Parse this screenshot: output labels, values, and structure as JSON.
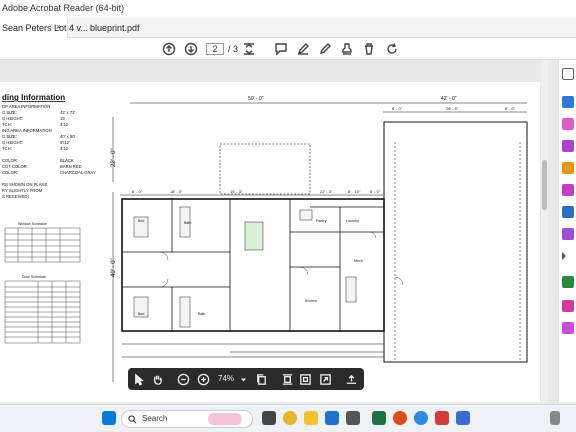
{
  "window": {
    "title": "Adobe Acrobat Reader (64-bit)"
  },
  "tabs": [
    {
      "label": "Sean Peters Lot 4 v...",
      "close": "×"
    },
    {
      "label": "blueprint.pdf"
    }
  ],
  "toolbar": {
    "page_current": "2",
    "page_total": "/ 3"
  },
  "zoom": {
    "value": "74%"
  },
  "taskbar": {
    "search_placeholder": "Search"
  },
  "blueprint": {
    "title": "ding Information",
    "info_lines": [
      "OP AREA INFORMATION",
      "G SIZE:",
      "G HEIGHT:",
      "TCH:",
      "ING AREA INFORMATION",
      "G SIZE:",
      "G HEIGHT:",
      "TCH:"
    ],
    "info_values": [
      "42' x 72'",
      "15'",
      "4:12",
      "",
      "40' x 50'",
      "9'/12'",
      "4:12"
    ],
    "color_lines": [
      "COLOR:",
      "COT COLOR:",
      "COLOR:"
    ],
    "color_values": [
      "BLACK",
      "BARN RED",
      "CHARCOAL GRAY"
    ],
    "note_lines": [
      "RS SHOWN ON PLANS",
      "RY SLIGHTLY FROM",
      "S RECEIVED)"
    ],
    "window_schedule_title": "Window Schedule",
    "door_schedule_title": "Door Schedule",
    "dims": {
      "top_left": "50' - 0\"",
      "top_right": "42' - 0\"",
      "left_total": "22' - 0\"",
      "left_lower": "40' - 0\"",
      "right_a": "8' - 0\"",
      "right_b": "26' - 0\"",
      "right_c": "8' - 0\"",
      "r1": "6' - 0\"",
      "r2": "18' - 0\"",
      "r3": "19' - 3\"",
      "r4": "22' - 3\"",
      "r5": "8' - 10\"",
      "r6": "6' - 0\""
    },
    "rooms": [
      "Pantry",
      "Laundry",
      "Bath",
      "Kitchen",
      "Mech",
      "Bed",
      "Bath",
      "Bed"
    ]
  }
}
